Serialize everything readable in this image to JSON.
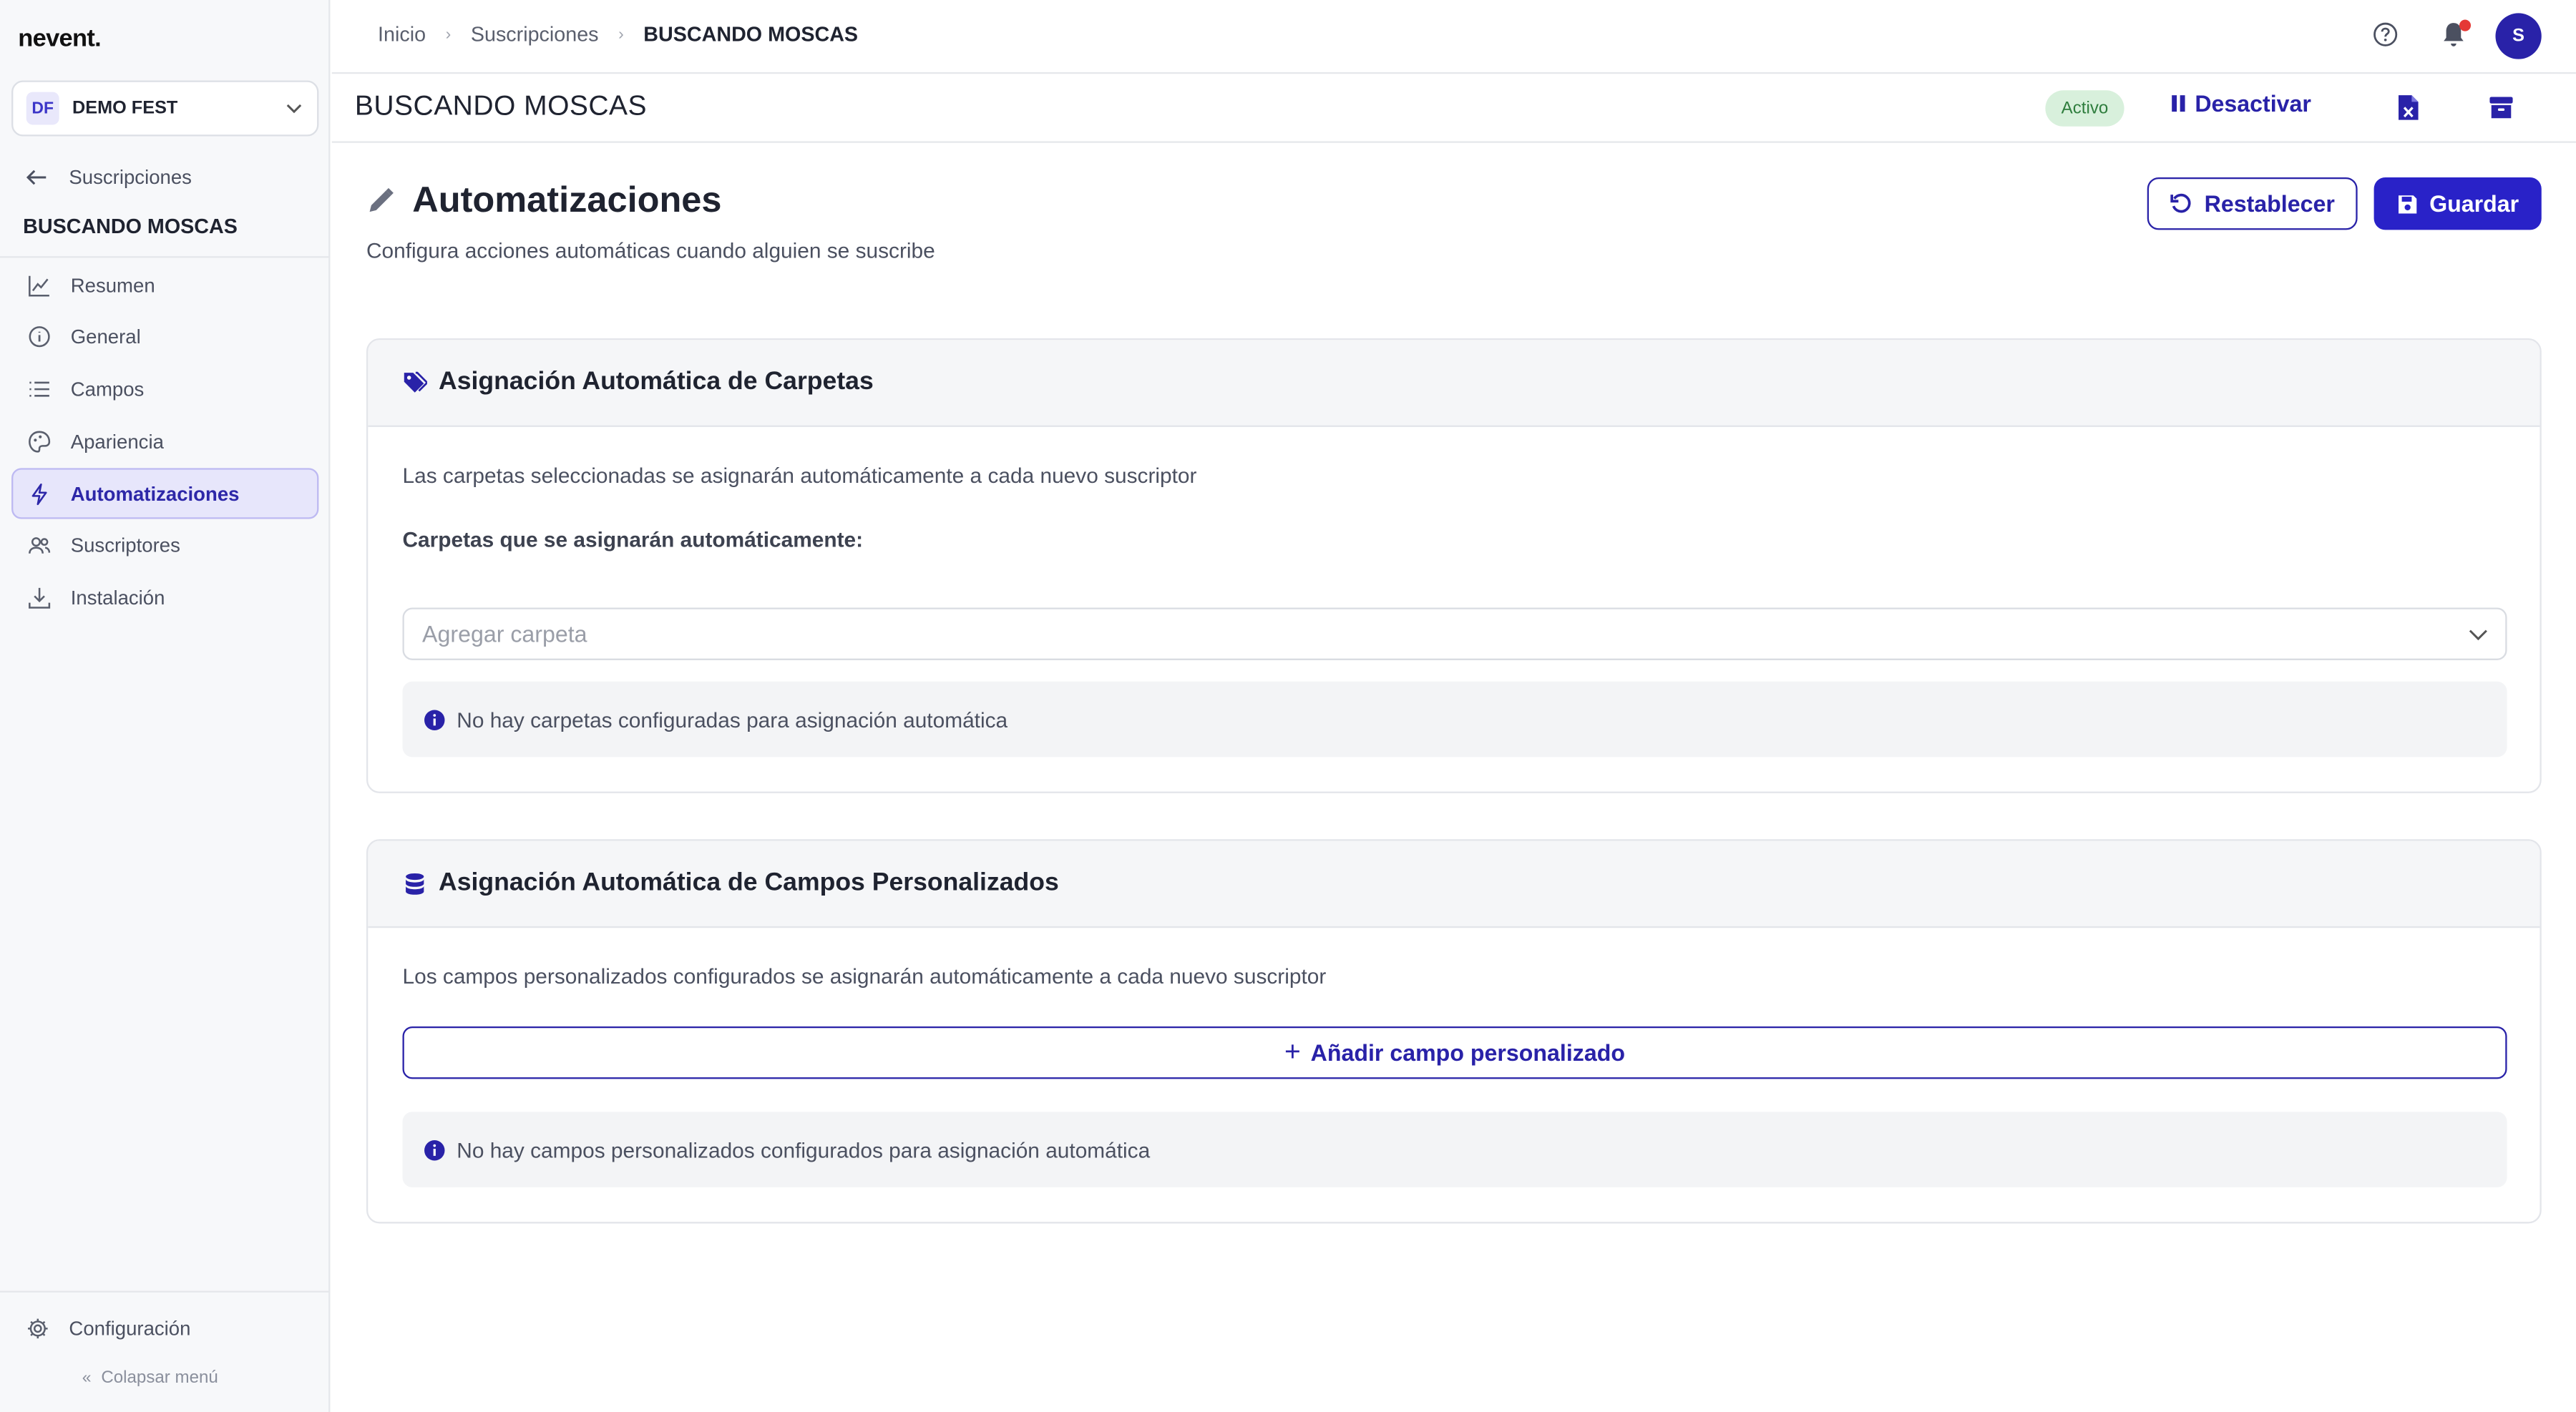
{
  "app": {
    "logo": "nevent."
  },
  "org": {
    "initials": "DF",
    "name": "DEMO FEST"
  },
  "sidebar": {
    "back_label": "Suscripciones",
    "section_title": "BUSCANDO MOSCAS",
    "items": [
      {
        "label": "Resumen",
        "icon": "chart-line-icon"
      },
      {
        "label": "General",
        "icon": "info-icon"
      },
      {
        "label": "Campos",
        "icon": "list-icon"
      },
      {
        "label": "Apariencia",
        "icon": "palette-icon"
      },
      {
        "label": "Automatizaciones",
        "icon": "bolt-icon",
        "active": true
      },
      {
        "label": "Suscriptores",
        "icon": "users-icon"
      },
      {
        "label": "Instalación",
        "icon": "download-icon"
      }
    ],
    "config_label": "Configuración",
    "collapse_label": "Colapsar menú"
  },
  "topbar": {
    "breadcrumbs": [
      "Inicio",
      "Suscripciones",
      "BUSCANDO MOSCAS"
    ],
    "avatar_initial": "S"
  },
  "page_header": {
    "title": "BUSCANDO MOSCAS",
    "status": "Activo",
    "deactivate_label": "Desactivar"
  },
  "content": {
    "title": "Automatizaciones",
    "subtitle": "Configura acciones automáticas cuando alguien se suscribe",
    "reset_label": "Restablecer",
    "save_label": "Guardar"
  },
  "folders_card": {
    "title": "Asignación Automática de Carpetas",
    "description": "Las carpetas seleccionadas se asignarán automáticamente a cada nuevo suscriptor",
    "label": "Carpetas que se asignarán automáticamente:",
    "select_placeholder": "Agregar carpeta",
    "empty_info": "No hay carpetas configuradas para asignación automática"
  },
  "fields_card": {
    "title": "Asignación Automática de Campos Personalizados",
    "description": "Los campos personalizados configurados se asignarán automáticamente a cada nuevo suscriptor",
    "add_label": "Añadir campo personalizado",
    "empty_info": "No hay campos personalizados configurados para asignación automática"
  },
  "colors": {
    "primary": "#2922a8",
    "active_bg": "#e7e6fb",
    "status_bg": "#d8f0dc",
    "status_text": "#2e7d3d",
    "notification": "#e53935"
  }
}
